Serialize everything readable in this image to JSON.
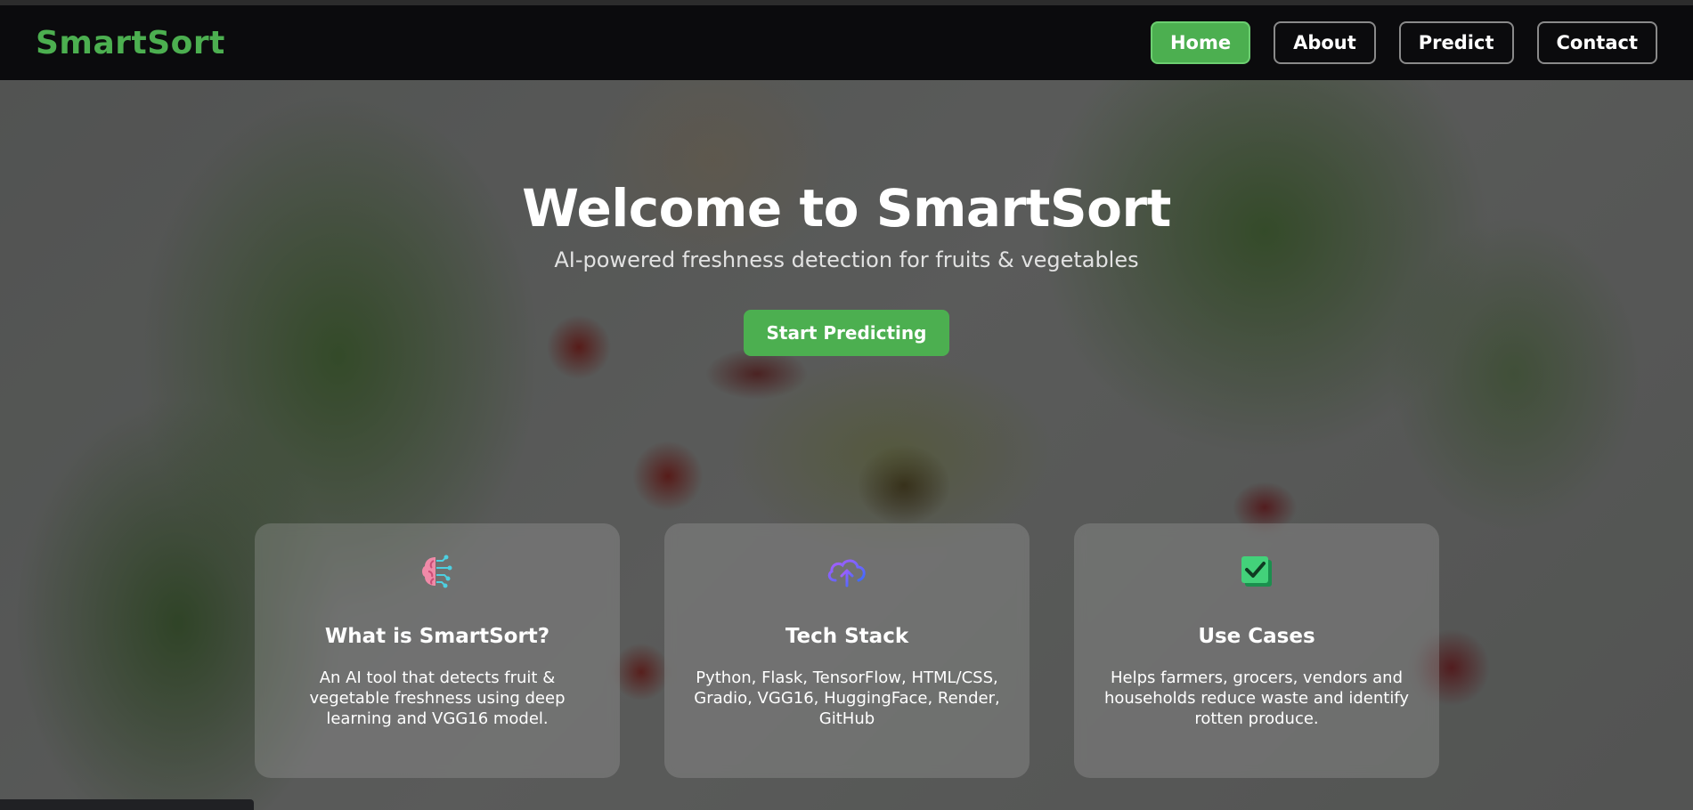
{
  "brand": "SmartSort",
  "nav": {
    "home": "Home",
    "about": "About",
    "predict": "Predict",
    "contact": "Contact"
  },
  "hero": {
    "title": "Welcome to SmartSort",
    "subtitle": "AI-powered freshness detection for fruits & vegetables",
    "cta": "Start Predicting"
  },
  "cards": [
    {
      "icon": "brain-icon",
      "title": "What is SmartSort?",
      "text": "An AI tool that detects fruit & vegetable freshness using deep learning and VGG16 model."
    },
    {
      "icon": "cloud-upload-icon",
      "title": "Tech Stack",
      "text": "Python, Flask, TensorFlow, HTML/CSS, Gradio, VGG16, HuggingFace, Render, GitHub"
    },
    {
      "icon": "check-box-icon",
      "title": "Use Cases",
      "text": "Helps farmers, grocers, vendors and households reduce waste and identify rotten produce."
    }
  ],
  "colors": {
    "accent": "#4caf50",
    "nav_bg": "#0b0b0d"
  }
}
